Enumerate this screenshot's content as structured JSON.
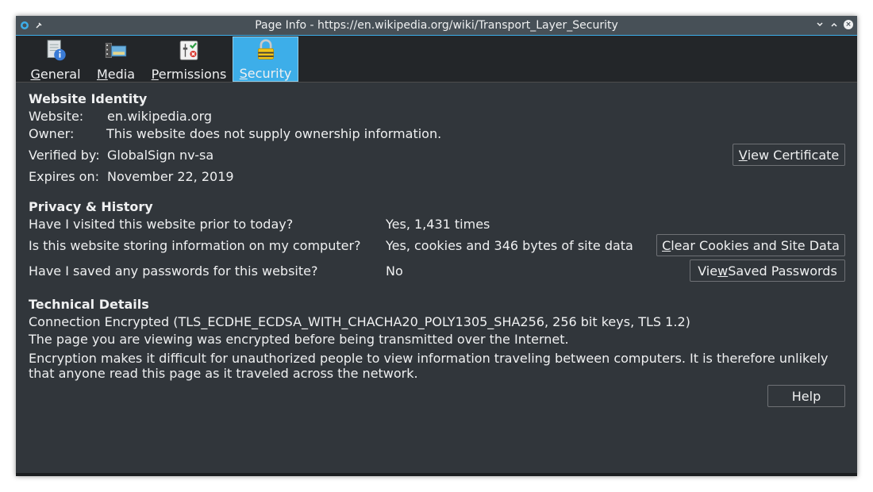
{
  "window": {
    "title": "Page Info - https://en.wikipedia.org/wiki/Transport_Layer_Security"
  },
  "tabs": [
    {
      "label": "General",
      "mnemonic": "G",
      "rest": "eneral",
      "icon": "document-info-icon"
    },
    {
      "label": "Media",
      "mnemonic": "M",
      "rest": "edia",
      "icon": "media-icon"
    },
    {
      "label": "Permissions",
      "mnemonic": "P",
      "rest": "ermissions",
      "icon": "permissions-icon"
    },
    {
      "label": "Security",
      "mnemonic": "S",
      "rest": "ecurity",
      "icon": "padlock-icon",
      "active": true
    }
  ],
  "identity": {
    "heading": "Website Identity",
    "website_label": "Website:",
    "website_value": "en.wikipedia.org",
    "owner_label": "Owner:",
    "owner_value": "This website does not supply ownership information.",
    "verified_label": "Verified by:",
    "verified_value": "GlobalSign nv-sa",
    "expires_label": "Expires on:",
    "expires_value": "November 22, 2019",
    "view_cert_mn": "V",
    "view_cert_rest": "iew Certificate"
  },
  "privacy": {
    "heading": "Privacy & History",
    "q1": "Have I visited this website prior to today?",
    "a1": "Yes, 1,431 times",
    "q2": "Is this website storing information on my computer?",
    "a2": "Yes, cookies and 346 bytes of site data",
    "clear_mn": "C",
    "clear_rest": "lear Cookies and Site Data",
    "q3": "Have I saved any passwords for this website?",
    "a3": "No",
    "pw_pre": "Vie",
    "pw_mn": "w",
    "pw_rest": " Saved Passwords"
  },
  "technical": {
    "heading": "Technical Details",
    "line1": "Connection Encrypted (TLS_ECDHE_ECDSA_WITH_CHACHA20_POLY1305_SHA256, 256 bit keys, TLS 1.2)",
    "line2": "The page you are viewing was encrypted before being transmitted over the Internet.",
    "line3a": "Encryption makes it difficult for unauthorized people to view information traveling between computers. It is therefore unlikely",
    "line3b": "that anyone read this page as it traveled across the network."
  },
  "help_label": "Help",
  "colors": {
    "accent": "#3daee9",
    "background": "#31363b",
    "text": "#eff0f1"
  }
}
